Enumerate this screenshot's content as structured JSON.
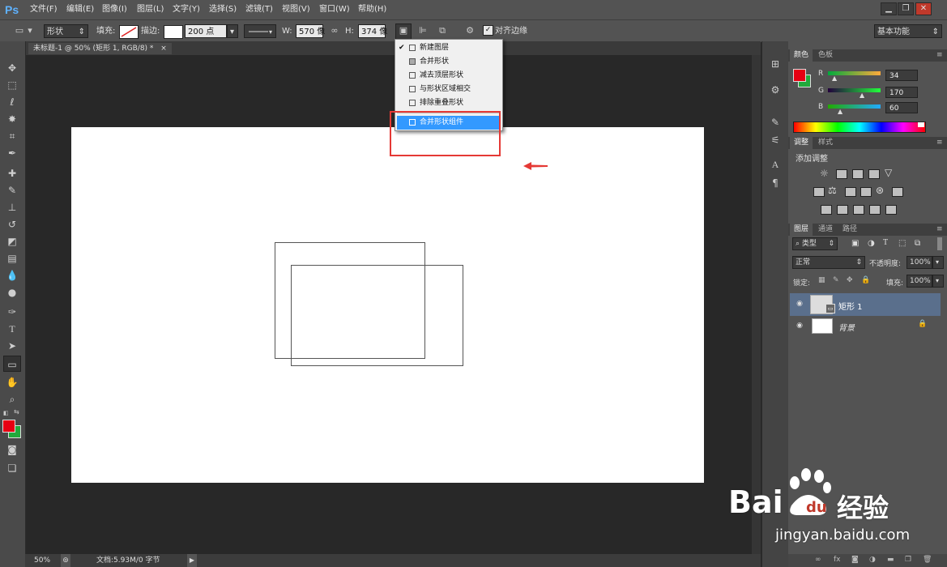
{
  "app": {
    "logo": "Ps"
  },
  "menu": [
    "文件(F)",
    "编辑(E)",
    "图像(I)",
    "图层(L)",
    "文字(Y)",
    "选择(S)",
    "滤镜(T)",
    "视图(V)",
    "窗口(W)",
    "帮助(H)"
  ],
  "window_buttons": [
    "▁",
    "❐",
    "✕"
  ],
  "options": {
    "shape_mode": "形状",
    "fill_label": "填充:",
    "stroke_label": "描边:",
    "stroke_width": "200 点",
    "w_label": "W:",
    "w_value": "570 像",
    "h_label": "H:",
    "h_value": "374 像",
    "align_edges": "对齐边缘",
    "workspace": "基本功能"
  },
  "document": {
    "tab": "未标题-1 @ 50% (矩形 1, RGB/8) *",
    "close": "×"
  },
  "status": {
    "zoom": "50%",
    "doc_info": "文档:5.93M/0 字节"
  },
  "dropdown": {
    "items": [
      {
        "label": "新建图层",
        "checked": "✔"
      },
      {
        "label": "合并形状",
        "checked": ""
      },
      {
        "label": "减去顶层形状",
        "checked": ""
      },
      {
        "label": "与形状区域相交",
        "checked": ""
      },
      {
        "label": "排除重叠形状",
        "checked": ""
      }
    ],
    "merge_components": "合并形状组件"
  },
  "color_panel": {
    "tabs": [
      "颜色",
      "色板"
    ],
    "r_label": "R",
    "r_value": "34",
    "g_label": "G",
    "g_value": "170",
    "b_label": "B",
    "b_value": "60",
    "foreground": "#e60012",
    "background": "#22aa3c"
  },
  "adjust_panel": {
    "tabs": [
      "调整",
      "样式"
    ],
    "title": "添加调整"
  },
  "layers_panel": {
    "tabs": [
      "图层",
      "通道",
      "路径"
    ],
    "filter_kind": "类型",
    "blend_mode": "正常",
    "opacity_label": "不透明度:",
    "opacity_value": "100%",
    "lock_label": "锁定:",
    "fill_label": "填充:",
    "fill_value": "100%",
    "layers": [
      {
        "name": "矩形 1"
      },
      {
        "name": "背景"
      }
    ]
  },
  "watermark": {
    "brand_bai": "Bai",
    "brand_du": "du",
    "brand_cn": "经验",
    "url": "jingyan.baidu.com"
  }
}
